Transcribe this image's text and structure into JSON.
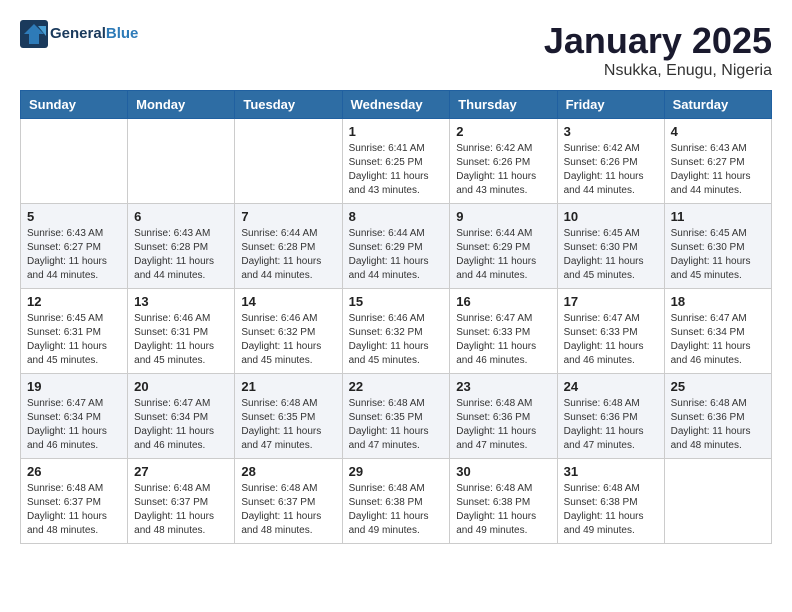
{
  "header": {
    "logo_line1": "General",
    "logo_line2": "Blue",
    "month": "January 2025",
    "location": "Nsukka, Enugu, Nigeria"
  },
  "days_of_week": [
    "Sunday",
    "Monday",
    "Tuesday",
    "Wednesday",
    "Thursday",
    "Friday",
    "Saturday"
  ],
  "weeks": [
    [
      {
        "day": "",
        "sunrise": "",
        "sunset": "",
        "daylight": ""
      },
      {
        "day": "",
        "sunrise": "",
        "sunset": "",
        "daylight": ""
      },
      {
        "day": "",
        "sunrise": "",
        "sunset": "",
        "daylight": ""
      },
      {
        "day": "1",
        "sunrise": "Sunrise: 6:41 AM",
        "sunset": "Sunset: 6:25 PM",
        "daylight": "Daylight: 11 hours and 43 minutes."
      },
      {
        "day": "2",
        "sunrise": "Sunrise: 6:42 AM",
        "sunset": "Sunset: 6:26 PM",
        "daylight": "Daylight: 11 hours and 43 minutes."
      },
      {
        "day": "3",
        "sunrise": "Sunrise: 6:42 AM",
        "sunset": "Sunset: 6:26 PM",
        "daylight": "Daylight: 11 hours and 44 minutes."
      },
      {
        "day": "4",
        "sunrise": "Sunrise: 6:43 AM",
        "sunset": "Sunset: 6:27 PM",
        "daylight": "Daylight: 11 hours and 44 minutes."
      }
    ],
    [
      {
        "day": "5",
        "sunrise": "Sunrise: 6:43 AM",
        "sunset": "Sunset: 6:27 PM",
        "daylight": "Daylight: 11 hours and 44 minutes."
      },
      {
        "day": "6",
        "sunrise": "Sunrise: 6:43 AM",
        "sunset": "Sunset: 6:28 PM",
        "daylight": "Daylight: 11 hours and 44 minutes."
      },
      {
        "day": "7",
        "sunrise": "Sunrise: 6:44 AM",
        "sunset": "Sunset: 6:28 PM",
        "daylight": "Daylight: 11 hours and 44 minutes."
      },
      {
        "day": "8",
        "sunrise": "Sunrise: 6:44 AM",
        "sunset": "Sunset: 6:29 PM",
        "daylight": "Daylight: 11 hours and 44 minutes."
      },
      {
        "day": "9",
        "sunrise": "Sunrise: 6:44 AM",
        "sunset": "Sunset: 6:29 PM",
        "daylight": "Daylight: 11 hours and 44 minutes."
      },
      {
        "day": "10",
        "sunrise": "Sunrise: 6:45 AM",
        "sunset": "Sunset: 6:30 PM",
        "daylight": "Daylight: 11 hours and 45 minutes."
      },
      {
        "day": "11",
        "sunrise": "Sunrise: 6:45 AM",
        "sunset": "Sunset: 6:30 PM",
        "daylight": "Daylight: 11 hours and 45 minutes."
      }
    ],
    [
      {
        "day": "12",
        "sunrise": "Sunrise: 6:45 AM",
        "sunset": "Sunset: 6:31 PM",
        "daylight": "Daylight: 11 hours and 45 minutes."
      },
      {
        "day": "13",
        "sunrise": "Sunrise: 6:46 AM",
        "sunset": "Sunset: 6:31 PM",
        "daylight": "Daylight: 11 hours and 45 minutes."
      },
      {
        "day": "14",
        "sunrise": "Sunrise: 6:46 AM",
        "sunset": "Sunset: 6:32 PM",
        "daylight": "Daylight: 11 hours and 45 minutes."
      },
      {
        "day": "15",
        "sunrise": "Sunrise: 6:46 AM",
        "sunset": "Sunset: 6:32 PM",
        "daylight": "Daylight: 11 hours and 45 minutes."
      },
      {
        "day": "16",
        "sunrise": "Sunrise: 6:47 AM",
        "sunset": "Sunset: 6:33 PM",
        "daylight": "Daylight: 11 hours and 46 minutes."
      },
      {
        "day": "17",
        "sunrise": "Sunrise: 6:47 AM",
        "sunset": "Sunset: 6:33 PM",
        "daylight": "Daylight: 11 hours and 46 minutes."
      },
      {
        "day": "18",
        "sunrise": "Sunrise: 6:47 AM",
        "sunset": "Sunset: 6:34 PM",
        "daylight": "Daylight: 11 hours and 46 minutes."
      }
    ],
    [
      {
        "day": "19",
        "sunrise": "Sunrise: 6:47 AM",
        "sunset": "Sunset: 6:34 PM",
        "daylight": "Daylight: 11 hours and 46 minutes."
      },
      {
        "day": "20",
        "sunrise": "Sunrise: 6:47 AM",
        "sunset": "Sunset: 6:34 PM",
        "daylight": "Daylight: 11 hours and 46 minutes."
      },
      {
        "day": "21",
        "sunrise": "Sunrise: 6:48 AM",
        "sunset": "Sunset: 6:35 PM",
        "daylight": "Daylight: 11 hours and 47 minutes."
      },
      {
        "day": "22",
        "sunrise": "Sunrise: 6:48 AM",
        "sunset": "Sunset: 6:35 PM",
        "daylight": "Daylight: 11 hours and 47 minutes."
      },
      {
        "day": "23",
        "sunrise": "Sunrise: 6:48 AM",
        "sunset": "Sunset: 6:36 PM",
        "daylight": "Daylight: 11 hours and 47 minutes."
      },
      {
        "day": "24",
        "sunrise": "Sunrise: 6:48 AM",
        "sunset": "Sunset: 6:36 PM",
        "daylight": "Daylight: 11 hours and 47 minutes."
      },
      {
        "day": "25",
        "sunrise": "Sunrise: 6:48 AM",
        "sunset": "Sunset: 6:36 PM",
        "daylight": "Daylight: 11 hours and 48 minutes."
      }
    ],
    [
      {
        "day": "26",
        "sunrise": "Sunrise: 6:48 AM",
        "sunset": "Sunset: 6:37 PM",
        "daylight": "Daylight: 11 hours and 48 minutes."
      },
      {
        "day": "27",
        "sunrise": "Sunrise: 6:48 AM",
        "sunset": "Sunset: 6:37 PM",
        "daylight": "Daylight: 11 hours and 48 minutes."
      },
      {
        "day": "28",
        "sunrise": "Sunrise: 6:48 AM",
        "sunset": "Sunset: 6:37 PM",
        "daylight": "Daylight: 11 hours and 48 minutes."
      },
      {
        "day": "29",
        "sunrise": "Sunrise: 6:48 AM",
        "sunset": "Sunset: 6:38 PM",
        "daylight": "Daylight: 11 hours and 49 minutes."
      },
      {
        "day": "30",
        "sunrise": "Sunrise: 6:48 AM",
        "sunset": "Sunset: 6:38 PM",
        "daylight": "Daylight: 11 hours and 49 minutes."
      },
      {
        "day": "31",
        "sunrise": "Sunrise: 6:48 AM",
        "sunset": "Sunset: 6:38 PM",
        "daylight": "Daylight: 11 hours and 49 minutes."
      },
      {
        "day": "",
        "sunrise": "",
        "sunset": "",
        "daylight": ""
      }
    ]
  ]
}
